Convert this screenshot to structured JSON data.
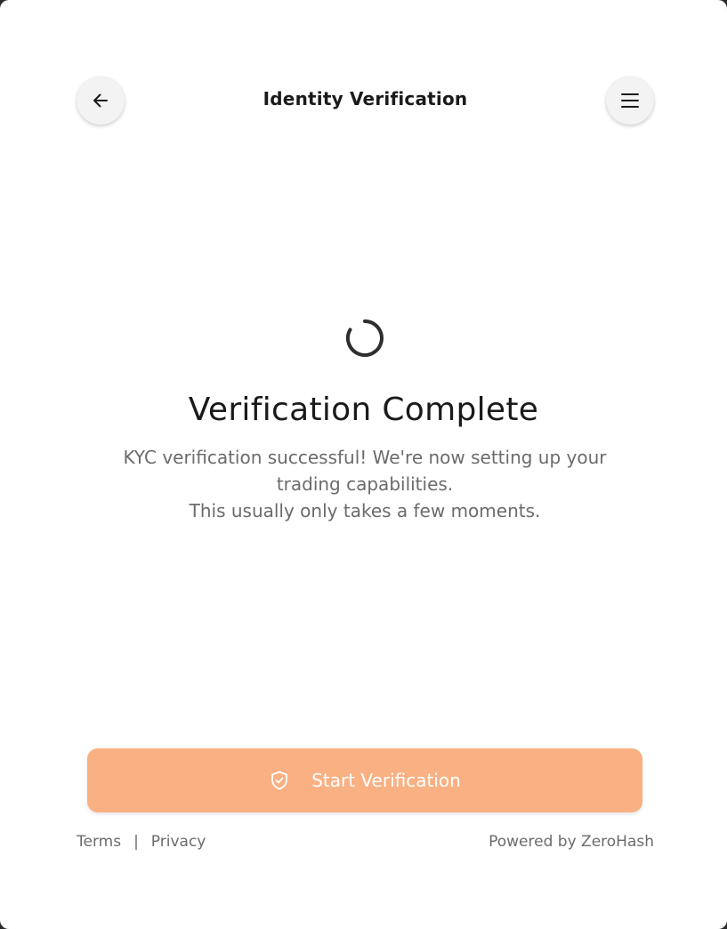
{
  "header": {
    "title": "Identity Verification",
    "back_icon": "arrow-left-icon",
    "menu_icon": "hamburger-menu-icon"
  },
  "status": {
    "spinner_icon": "loading-spinner-icon",
    "title": "Verification Complete",
    "description_line1": "KYC verification successful! We're now setting up your trading capabilities.",
    "description_line2": "This usually only takes a few moments."
  },
  "actions": {
    "primary_label": "Start Verification",
    "primary_icon": "shield-check-icon",
    "primary_color": "#f9b082"
  },
  "footer": {
    "terms_label": "Terms",
    "separator": "|",
    "privacy_label": "Privacy",
    "powered_by": "Powered by ZeroHash"
  }
}
